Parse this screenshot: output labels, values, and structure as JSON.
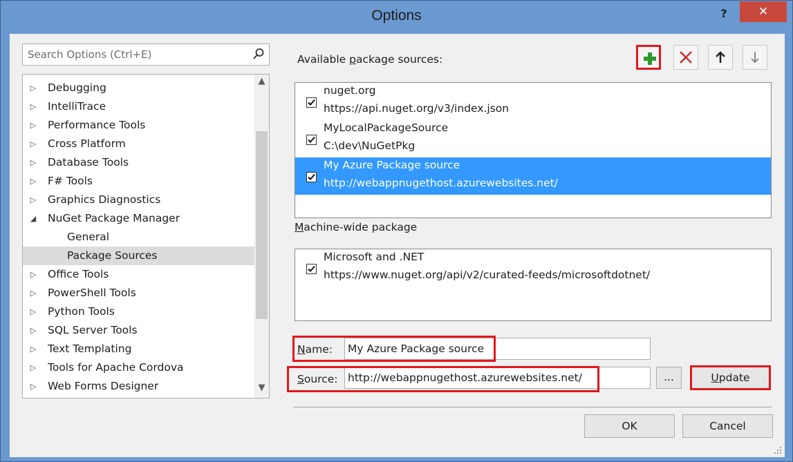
{
  "window": {
    "title": "Options",
    "help_label": "?",
    "close_label": "✕"
  },
  "search": {
    "placeholder": "Search Options (Ctrl+E)"
  },
  "tree": {
    "items": [
      {
        "label": "Debugging",
        "expander": "▷",
        "level": 0
      },
      {
        "label": "IntelliTrace",
        "expander": "▷",
        "level": 0
      },
      {
        "label": "Performance Tools",
        "expander": "▷",
        "level": 0
      },
      {
        "label": "Cross Platform",
        "expander": "▷",
        "level": 0
      },
      {
        "label": "Database Tools",
        "expander": "▷",
        "level": 0
      },
      {
        "label": "F# Tools",
        "expander": "▷",
        "level": 0
      },
      {
        "label": "Graphics Diagnostics",
        "expander": "▷",
        "level": 0
      },
      {
        "label": "NuGet Package Manager",
        "expander": "◢",
        "level": 0
      },
      {
        "label": "General",
        "expander": "",
        "level": 1
      },
      {
        "label": "Package Sources",
        "expander": "",
        "level": 1,
        "selected": true
      },
      {
        "label": "Office Tools",
        "expander": "▷",
        "level": 0
      },
      {
        "label": "PowerShell Tools",
        "expander": "▷",
        "level": 0
      },
      {
        "label": "Python Tools",
        "expander": "▷",
        "level": 0
      },
      {
        "label": "SQL Server Tools",
        "expander": "▷",
        "level": 0
      },
      {
        "label": "Text Templating",
        "expander": "▷",
        "level": 0
      },
      {
        "label": "Tools for Apache Cordova",
        "expander": "▷",
        "level": 0
      },
      {
        "label": "Web Forms Designer",
        "expander": "▷",
        "level": 0
      }
    ]
  },
  "available": {
    "label_prefix": "Available ",
    "label_accel": "p",
    "label_suffix": "ackage sources:",
    "sources": [
      {
        "name": "nuget.org",
        "url": "https://api.nuget.org/v3/index.json",
        "checked": true
      },
      {
        "name": "MyLocalPackageSource",
        "url": "C:\\dev\\NuGetPkg",
        "checked": true
      },
      {
        "name": "My Azure Package source",
        "url": "http://webappnugethost.azurewebsites.net/",
        "checked": true,
        "selected": true
      }
    ]
  },
  "machine_wide": {
    "label_accel": "M",
    "label_rest": "achine-wide package",
    "sources": [
      {
        "name": "Microsoft and .NET",
        "url": "https://www.nuget.org/api/v2/curated-feeds/microsoftdotnet/",
        "checked": true
      }
    ]
  },
  "form": {
    "name_label_accel": "N",
    "name_label_rest": "ame:",
    "name_value": "My Azure Package source",
    "source_label_accel": "S",
    "source_label_rest": "ource:",
    "source_value": "http://webappnugethost.azurewebsites.net/",
    "browse_label": "...",
    "update_label_accel": "U",
    "update_label_rest": "pdate"
  },
  "dialog": {
    "ok_label": "OK",
    "cancel_label": "Cancel"
  },
  "colors": {
    "highlight_red": "#e3171c",
    "selection_blue": "#3399ff",
    "add_green": "#2b9a2b",
    "remove_red": "#c9302c",
    "title_bar": "#6b9ad1"
  },
  "icons": {
    "toolbar": [
      "add-icon",
      "remove-icon",
      "move-up-icon",
      "move-down-icon"
    ]
  }
}
